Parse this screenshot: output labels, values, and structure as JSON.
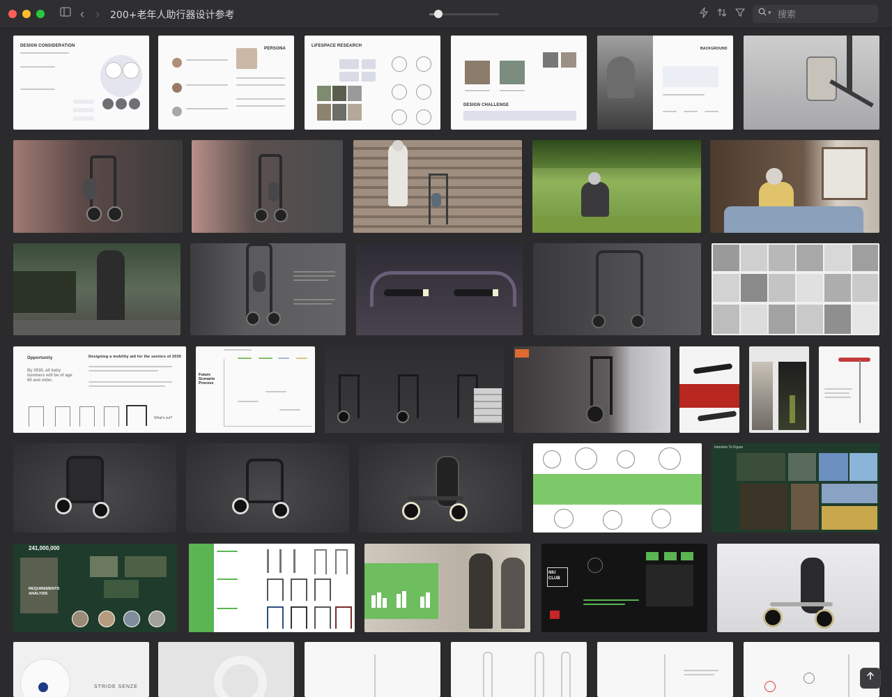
{
  "window": {
    "title": "200+老年人助行器设计参考",
    "zoom_level": 0.13
  },
  "toolbar": {
    "sidebar_icon": "sidebar-toggle-icon",
    "back_icon": "chevron-left-icon",
    "forward_icon": "chevron-right-icon",
    "bolt_icon": "bolt-icon",
    "sort_icon": "sort-icon",
    "filter_icon": "filter-icon"
  },
  "search": {
    "placeholder": "搜索"
  },
  "thumbnails": {
    "design_consideration": "DESIGN CONSIDERATION",
    "persona": "PERSONA",
    "lifespace": "LIFESPACE RESEARCH",
    "design_challenge": "DESIGN CHALLENGE",
    "background": "BACKGROUND",
    "opportunity": "Opportunity",
    "opportunity_heading": "Designing a mobility aid for the seniors of 2030",
    "boomers": "By 2030, all baby boomers will be of age 65 and older.",
    "whats_out": "What's out?",
    "future": "Future Scenario Process",
    "intention": "Intention To Figure",
    "requirements": "REQUIREMENTS ANALYSIS",
    "big_number": "241,000,000",
    "niu_club": "NIU CLUB",
    "stride": "STRIDE SENZE"
  },
  "colors": {
    "background": "#2b2b2d",
    "green": "#5ab552",
    "dark_green": "#1f3b2c"
  }
}
